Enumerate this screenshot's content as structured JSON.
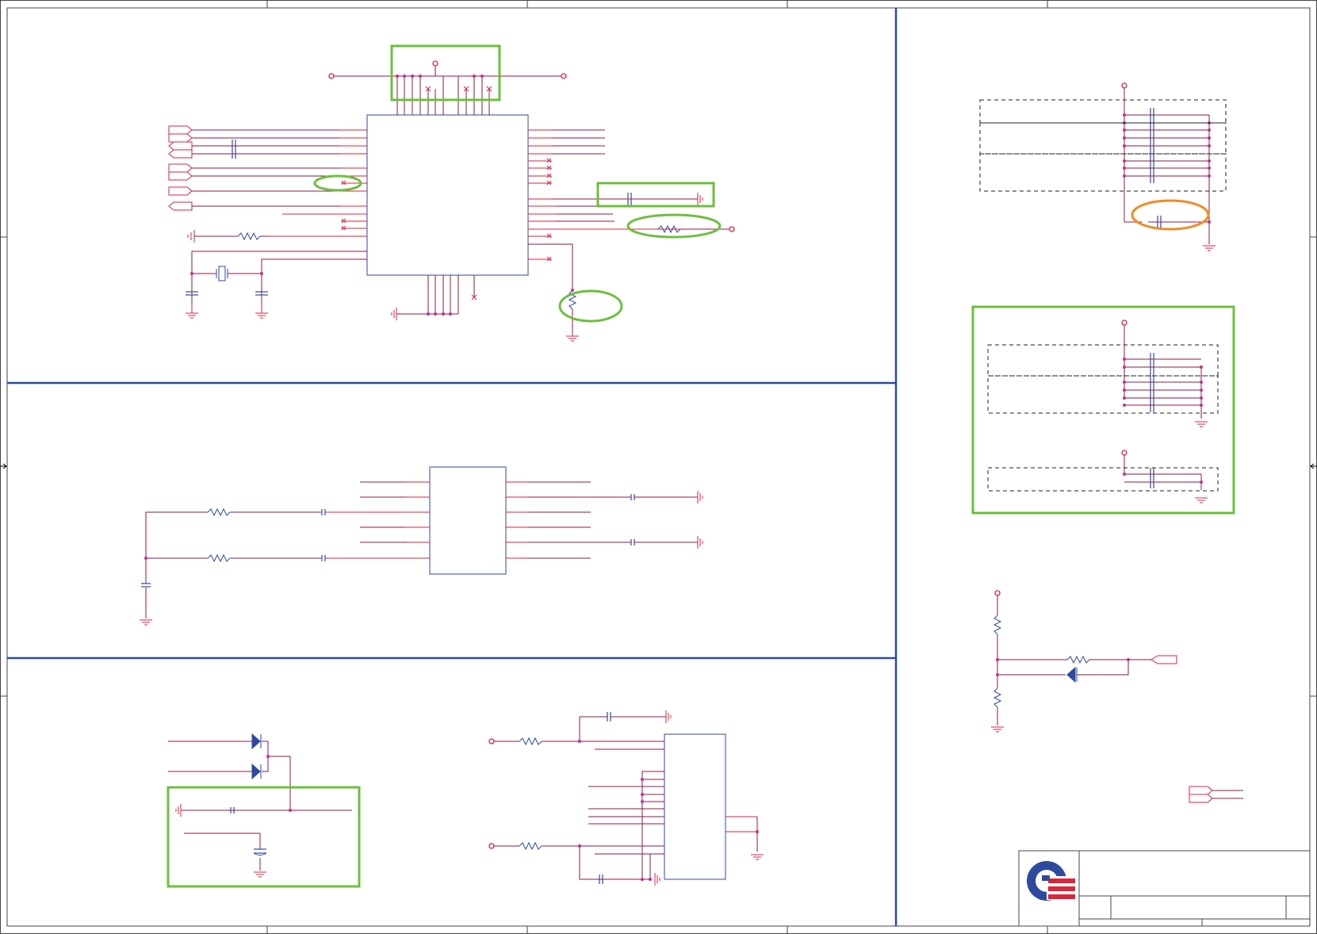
{
  "title": "",
  "colors": {
    "frame": "#444444",
    "divider": "#2e4a9e",
    "part": "#2e4a9e",
    "wire": "#8b1a4a",
    "pin": "#d9263a",
    "junction": "#c0318a",
    "highlight": "#6cbf3e",
    "highlight_alt": "#f08a24",
    "logo_blue": "#2e4a9e",
    "logo_red": "#d9263a"
  },
  "sections": [
    {
      "id": "top-left-ic-block",
      "highlighted_regions": 5
    },
    {
      "id": "mid-left-ic-block",
      "highlighted_regions": 0
    },
    {
      "id": "bottom-left-block",
      "highlighted_regions": 1
    },
    {
      "id": "right-decoupling-block",
      "highlighted_regions": 2
    },
    {
      "id": "right-reset-block",
      "highlighted_regions": 0
    }
  ],
  "title_block": {
    "logo_icon": "company-logo-icon"
  }
}
